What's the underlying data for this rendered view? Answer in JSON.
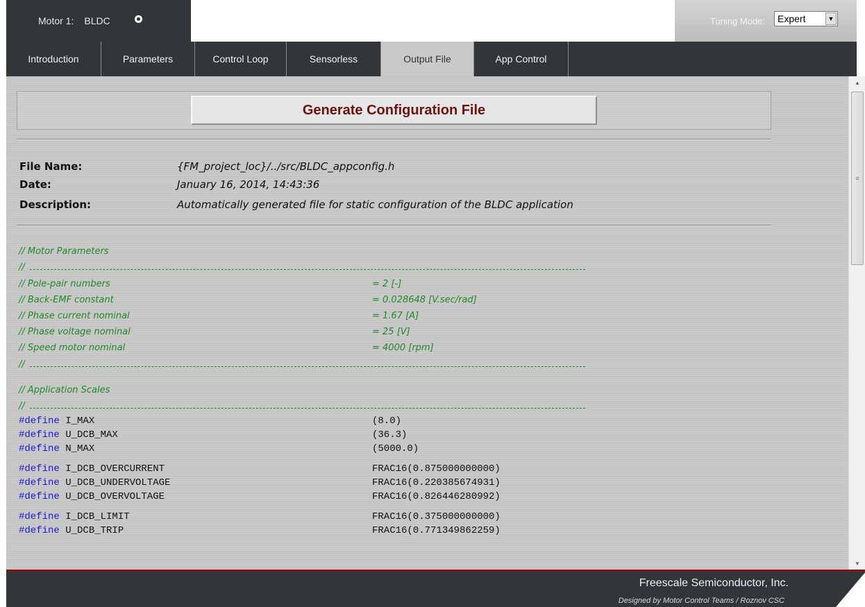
{
  "header": {
    "motor_label": "Motor 1:",
    "motor_type": "BLDC",
    "tuning_label": "Tuning Mode:",
    "tuning_value": "Expert"
  },
  "tabs": [
    {
      "label": "Introduction",
      "active": false
    },
    {
      "label": "Parameters",
      "active": false
    },
    {
      "label": "Control Loop",
      "active": false
    },
    {
      "label": "Sensorless",
      "active": false
    },
    {
      "label": "Output File",
      "active": true
    },
    {
      "label": "App Control",
      "active": false
    }
  ],
  "generate_button": "Generate Configuration File",
  "file_info": {
    "file_name_label": "File Name:",
    "file_name": "{FM_project_loc}/../src/BLDC_appconfig.h",
    "date_label": "Date:",
    "date": "January 16, 2014, 14:43:36",
    "description_label": "Description:",
    "description": "Automatically generated file for static configuration of the BLDC application"
  },
  "motor_params": {
    "heading": "// Motor Parameters",
    "separator": "//",
    "rows": [
      {
        "name": "// Pole-pair numbers",
        "value": "= 2 [-]"
      },
      {
        "name": "// Back-EMF constant",
        "value": "= 0.028648 [V.sec/rad]"
      },
      {
        "name": "// Phase current nominal",
        "value": "= 1.67 [A]"
      },
      {
        "name": "// Phase voltage nominal",
        "value": "= 25 [V]"
      },
      {
        "name": "// Speed motor nominal",
        "value": "= 4000 [rpm]"
      }
    ]
  },
  "app_scales": {
    "heading": "// Application Scales",
    "keyword": "#define",
    "defines": [
      {
        "name": "I_MAX",
        "value": "(8.0)"
      },
      {
        "name": "U_DCB_MAX",
        "value": "(36.3)"
      },
      {
        "name": "N_MAX",
        "value": "(5000.0)"
      },
      {
        "name": "I_DCB_OVERCURRENT",
        "value": "FRAC16(0.875000000000)"
      },
      {
        "name": "U_DCB_UNDERVOLTAGE",
        "value": "FRAC16(0.220385674931)"
      },
      {
        "name": "U_DCB_OVERVOLTAGE",
        "value": "FRAC16(0.826446280992)"
      },
      {
        "name": "I_DCB_LIMIT",
        "value": "FRAC16(0.375000000000)"
      },
      {
        "name": "U_DCB_TRIP",
        "value": "FRAC16(0.771349862259)"
      }
    ]
  },
  "footer": {
    "company": "Freescale Semiconductor, Inc.",
    "credit": "Designed by Motor Control Teams / Roznov CSC"
  },
  "colors": {
    "dark_bar": "#333638",
    "accent_red": "#7c1515",
    "comment_green": "#22882a",
    "keyword_blue": "#1a1ad0"
  }
}
